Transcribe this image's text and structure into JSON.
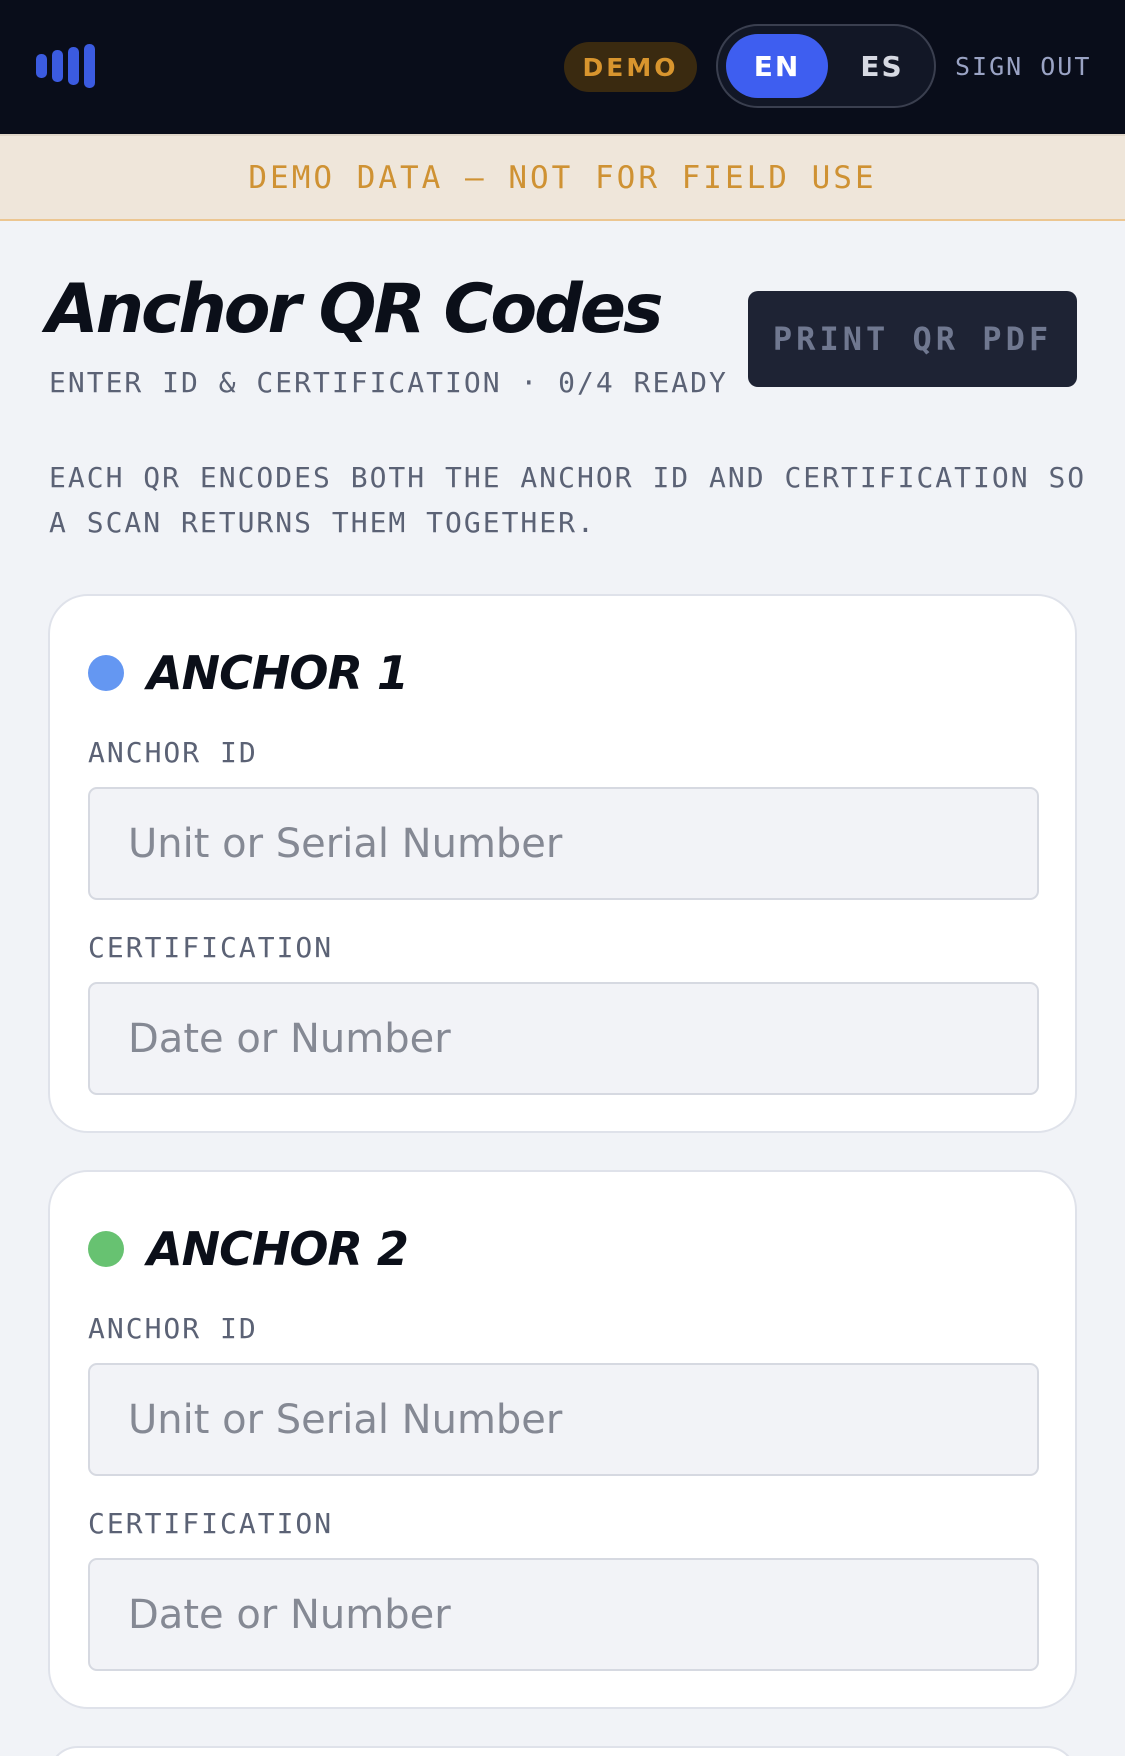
{
  "header": {
    "logo_icon": "signal-bars-icon",
    "demo_badge": "DEMO",
    "languages": [
      {
        "code": "EN",
        "active": true
      },
      {
        "code": "ES",
        "active": false
      }
    ],
    "sign_out": "SIGN OUT"
  },
  "banner": {
    "text": "DEMO DATA — NOT FOR FIELD USE"
  },
  "page": {
    "title": "Anchor QR Codes",
    "subtitle": "ENTER ID & CERTIFICATION · 0/4 READY",
    "print_button": "PRINT QR PDF",
    "description": "EACH QR ENCODES BOTH THE ANCHOR ID AND CERTIFICATION SO A SCAN RETURNS THEM TOGETHER."
  },
  "anchors": [
    {
      "title": "ANCHOR 1",
      "dot_color": "#6497f2",
      "id_label": "ANCHOR ID",
      "id_placeholder": "Unit or Serial Number",
      "id_value": "",
      "cert_label": "CERTIFICATION",
      "cert_placeholder": "Date or Number",
      "cert_value": ""
    },
    {
      "title": "ANCHOR 2",
      "dot_color": "#67c271",
      "id_label": "ANCHOR ID",
      "id_placeholder": "Unit or Serial Number",
      "id_value": "",
      "cert_label": "CERTIFICATION",
      "cert_placeholder": "Date or Number",
      "cert_value": ""
    }
  ],
  "colors": {
    "accent": "#3e5ef0",
    "topbar_bg": "#090d1a",
    "banner_bg": "#efe6da",
    "banner_text": "#cf9233",
    "page_bg": "#f1f3f7"
  }
}
